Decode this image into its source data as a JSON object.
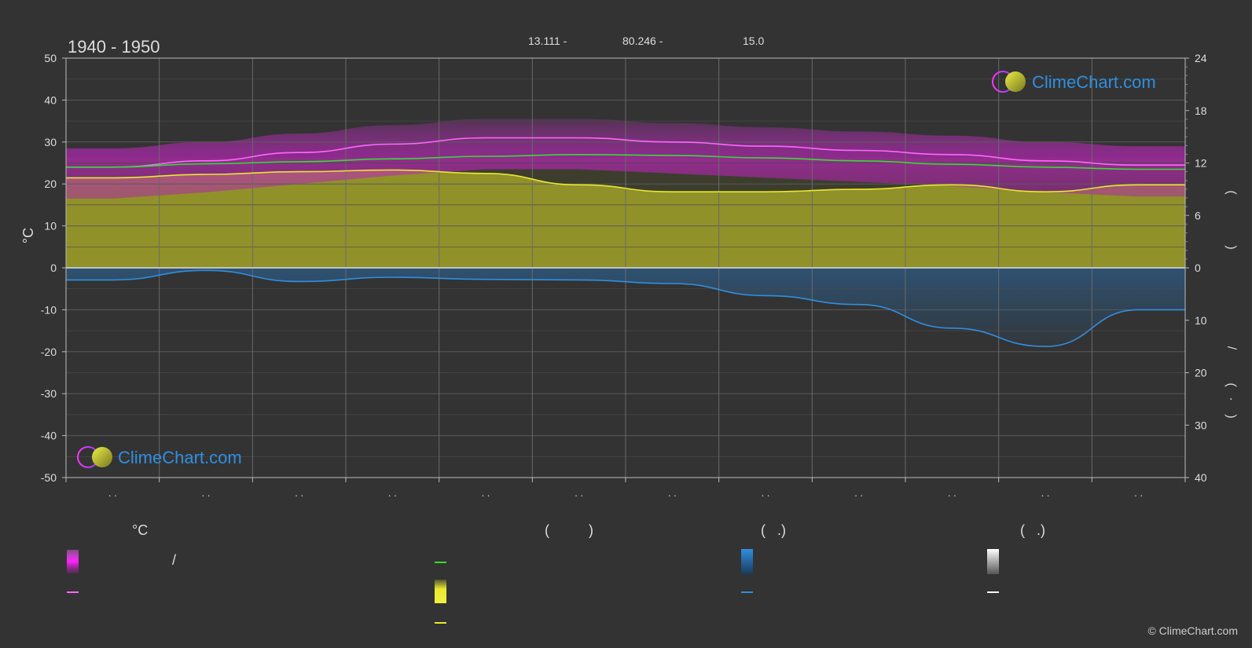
{
  "header": {
    "period": "1940 - 1950",
    "coord_lat": "13.111 -",
    "coord_lon": "80.246 -",
    "elevation": "15.0"
  },
  "chart_data": {
    "type": "line",
    "months": 12,
    "x_tick_labels": [
      ". .",
      ". .",
      ". .",
      ". .",
      ". .",
      ". .",
      ". .",
      ". .",
      ". .",
      ". .",
      ". .",
      ". ."
    ],
    "left_axis": {
      "label": "°C",
      "ticks": [
        50,
        40,
        30,
        20,
        10,
        0,
        -10,
        -20,
        -30,
        -40,
        -50
      ],
      "ylim": [
        -50,
        50
      ]
    },
    "right_axis_upper": {
      "ticks": [
        24,
        18,
        12,
        6,
        0
      ],
      "range": [
        0,
        24
      ],
      "label_glyphs": [
        "(",
        ")"
      ]
    },
    "right_axis_lower": {
      "ticks": [
        0,
        10,
        20,
        30,
        40
      ],
      "range": [
        0,
        40
      ],
      "label_glyphs": [
        "/",
        "(",
        "·",
        ")"
      ]
    },
    "series": [
      {
        "key": "max_temp",
        "color": "#ff66ff",
        "values": [
          24.0,
          25.5,
          27.5,
          29.5,
          31.0,
          31.0,
          30.0,
          29.0,
          28.0,
          27.0,
          25.5,
          24.5
        ]
      },
      {
        "key": "avg_temp",
        "color": "#33dd33",
        "values": [
          24.0,
          24.8,
          25.3,
          26.0,
          26.6,
          27.0,
          26.8,
          26.2,
          25.5,
          24.7,
          24.0,
          23.5
        ]
      },
      {
        "key": "sunshine_hours",
        "color": "#e8e830",
        "axis": "right_upper",
        "values": [
          10.3,
          10.7,
          11.0,
          11.2,
          10.8,
          9.5,
          8.7,
          8.7,
          9.0,
          9.5,
          8.7,
          9.5
        ]
      },
      {
        "key": "precipitation_mm",
        "color": "#2f8fe0",
        "axis": "right_lower",
        "values": [
          2.3,
          0.5,
          2.6,
          1.8,
          2.2,
          2.3,
          3.0,
          5.3,
          7.0,
          11.5,
          15.0,
          8.0
        ]
      }
    ],
    "daylight_fill_color": "#9a9a2a",
    "grid": true
  },
  "legend": {
    "col1": {
      "heading": "°C",
      "row1_text": "/"
    },
    "col2": {
      "heading": "(          )"
    },
    "col3": {
      "heading": "(   .)"
    },
    "col4": {
      "heading": "(   .)"
    },
    "colors": {
      "magenta": "#ff33ff",
      "green": "#33dd33",
      "yellow": "#e8e830",
      "blue": "#2f8fe0",
      "white": "#ffffff"
    }
  },
  "watermark": {
    "text": "ClimeChart.com"
  },
  "copyright": "© ClimeChart.com"
}
